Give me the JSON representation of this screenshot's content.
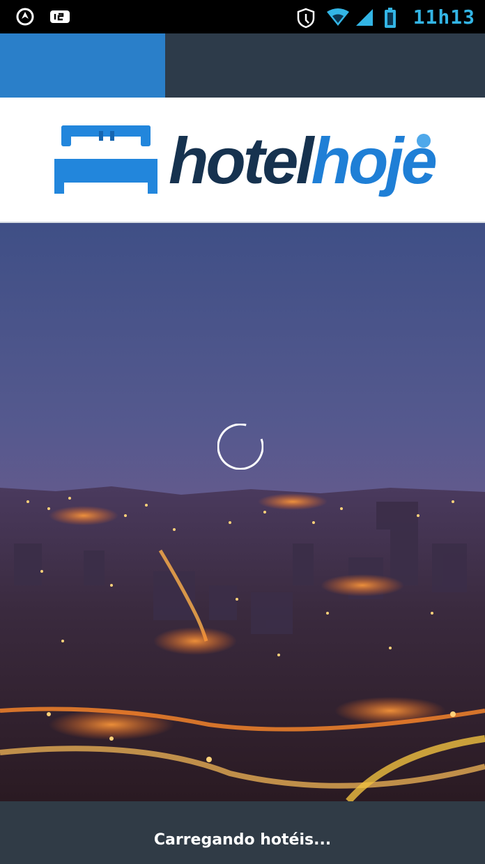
{
  "status_bar": {
    "left_icons": [
      "navigation-icon",
      "usb-icon"
    ],
    "right_icons": [
      "shield-icon",
      "wifi-icon",
      "signal-icon",
      "battery-icon"
    ],
    "time": "11h13",
    "accent_color": "#33b5e5"
  },
  "loading_progress": {
    "fraction": 0.34,
    "fill_color": "#2a7fc9",
    "track_color": "#2d3b4a"
  },
  "header": {
    "logo_part1": "hotel",
    "logo_part2": "hoje",
    "logo_color_dark": "#16324f",
    "logo_color_blue": "#1f7fd6",
    "logo_icon": "bed-icon"
  },
  "hero": {
    "image": "city-night-skyline",
    "spinner_icon": "loading-spinner-icon"
  },
  "footer": {
    "status_text": "Carregando hotéis..."
  }
}
